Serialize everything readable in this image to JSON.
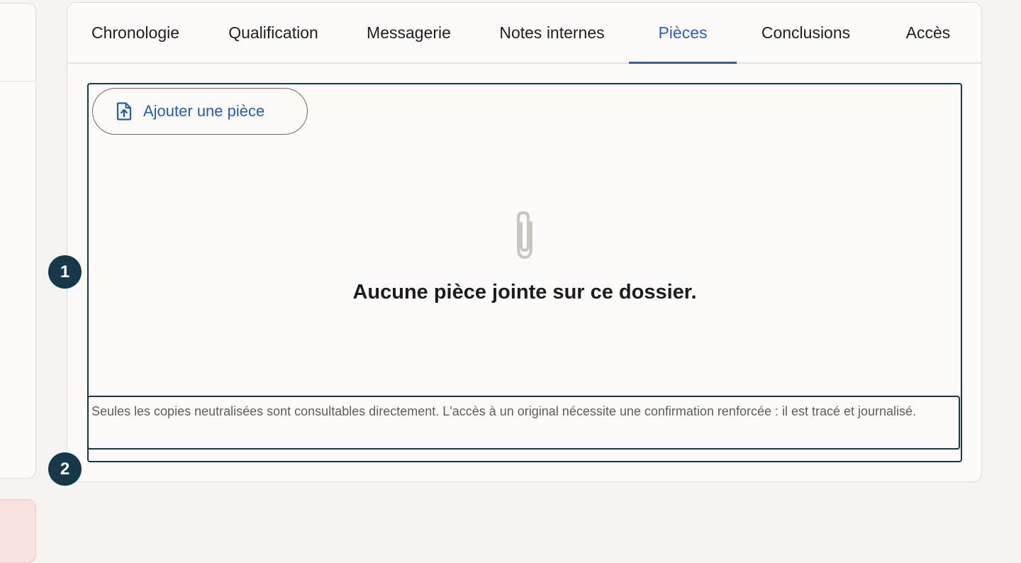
{
  "tabs": [
    {
      "label": "Chronologie",
      "active": false
    },
    {
      "label": "Qualification",
      "active": false
    },
    {
      "label": "Messagerie",
      "active": false
    },
    {
      "label": "Notes internes",
      "active": false
    },
    {
      "label": "Pièces",
      "active": true
    },
    {
      "label": "Conclusions",
      "active": false
    },
    {
      "label": "Accès",
      "active": false
    }
  ],
  "pieces": {
    "add_button_label": "Ajouter une pièce",
    "add_button_icon": "file-upload-icon",
    "empty_icon": "paperclip-icon",
    "empty_message": "Aucune pièce jointe sur ce dossier.",
    "notice": "Seules les copies neutralisées sont consultables directement. L'accès à un original nécessite une confirmation renforcée : il est tracé et journalisé."
  },
  "markers": [
    "1",
    "2"
  ],
  "colors": {
    "accent": "#2d5fbf",
    "link": "#1f5fa8",
    "highlight_border": "#15384a",
    "background": "#f6f4f1",
    "card": "#fcfbfa"
  }
}
